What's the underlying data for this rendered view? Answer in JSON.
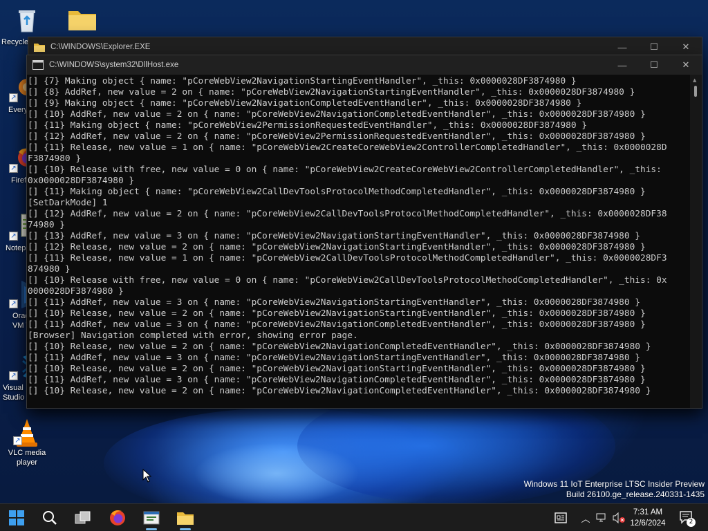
{
  "desktop": {
    "icons": [
      {
        "label": "Recycle Bin",
        "name": "recycle-bin"
      },
      {
        "label": "",
        "name": "folder"
      },
      {
        "label": "Everything",
        "name": "everything"
      },
      {
        "label": "Firefox",
        "name": "firefox"
      },
      {
        "label": "Notepad++",
        "name": "notepad-plus-plus"
      },
      {
        "label": "Oracle VM VirtualBox",
        "name": "virtualbox"
      },
      {
        "label": "Visual Studio Code",
        "name": "vscode"
      },
      {
        "label": "VLC media player",
        "name": "vlc"
      }
    ]
  },
  "windows": {
    "explorer": {
      "title": "C:\\WINDOWS\\Explorer.EXE"
    },
    "dllhost": {
      "title": "C:\\WINDOWS\\system32\\DllHost.exe"
    }
  },
  "console": {
    "lines": [
      "[] {7} Making object { name: \"pCoreWebView2NavigationStartingEventHandler\", _this: 0x0000028DF3874980 }",
      "[] {8} AddRef, new value = 2 on { name: \"pCoreWebView2NavigationStartingEventHandler\", _this: 0x0000028DF3874980 }",
      "[] {9} Making object { name: \"pCoreWebView2NavigationCompletedEventHandler\", _this: 0x0000028DF3874980 }",
      "[] {10} AddRef, new value = 2 on { name: \"pCoreWebView2NavigationCompletedEventHandler\", _this: 0x0000028DF3874980 }",
      "[] {11} Making object { name: \"pCoreWebView2PermissionRequestedEventHandler\", _this: 0x0000028DF3874980 }",
      "[] {12} AddRef, new value = 2 on { name: \"pCoreWebView2PermissionRequestedEventHandler\", _this: 0x0000028DF3874980 }",
      "[] {11} Release, new value = 1 on { name: \"pCoreWebView2CreateCoreWebView2ControllerCompletedHandler\", _this: 0x0000028D",
      "F3874980 }",
      "[] {10} Release with free, new value = 0 on { name: \"pCoreWebView2CreateCoreWebView2ControllerCompletedHandler\", _this:",
      "0x0000028DF3874980 }",
      "[] {11} Making object { name: \"pCoreWebView2CallDevToolsProtocolMethodCompletedHandler\", _this: 0x0000028DF3874980 }",
      "[SetDarkMode] 1",
      "[] {12} AddRef, new value = 2 on { name: \"pCoreWebView2CallDevToolsProtocolMethodCompletedHandler\", _this: 0x0000028DF38",
      "74980 }",
      "[] {13} AddRef, new value = 3 on { name: \"pCoreWebView2NavigationStartingEventHandler\", _this: 0x0000028DF3874980 }",
      "[] {12} Release, new value = 2 on { name: \"pCoreWebView2NavigationStartingEventHandler\", _this: 0x0000028DF3874980 }",
      "[] {11} Release, new value = 1 on { name: \"pCoreWebView2CallDevToolsProtocolMethodCompletedHandler\", _this: 0x0000028DF3",
      "874980 }",
      "[] {10} Release with free, new value = 0 on { name: \"pCoreWebView2CallDevToolsProtocolMethodCompletedHandler\", _this: 0x",
      "0000028DF3874980 }",
      "[] {11} AddRef, new value = 3 on { name: \"pCoreWebView2NavigationStartingEventHandler\", _this: 0x0000028DF3874980 }",
      "[] {10} Release, new value = 2 on { name: \"pCoreWebView2NavigationStartingEventHandler\", _this: 0x0000028DF3874980 }",
      "[] {11} AddRef, new value = 3 on { name: \"pCoreWebView2NavigationCompletedEventHandler\", _this: 0x0000028DF3874980 }",
      "[Browser] Navigation completed with error, showing error page.",
      "[] {10} Release, new value = 2 on { name: \"pCoreWebView2NavigationCompletedEventHandler\", _this: 0x0000028DF3874980 }",
      "[] {11} AddRef, new value = 3 on { name: \"pCoreWebView2NavigationStartingEventHandler\", _this: 0x0000028DF3874980 }",
      "[] {10} Release, new value = 2 on { name: \"pCoreWebView2NavigationStartingEventHandler\", _this: 0x0000028DF3874980 }",
      "[] {11} AddRef, new value = 3 on { name: \"pCoreWebView2NavigationCompletedEventHandler\", _this: 0x0000028DF3874980 }",
      "[] {10} Release, new value = 2 on { name: \"pCoreWebView2NavigationCompletedEventHandler\", _this: 0x0000028DF3874980 }"
    ]
  },
  "watermark": {
    "line1": "Windows 11 IoT Enterprise LTSC Insider Preview",
    "line2": "Build 26100.ge_release.240331-1435"
  },
  "taskbar": {
    "apps": [
      "start-icon",
      "search-icon",
      "task-view-icon",
      "firefox-icon",
      "dllhost-console-icon",
      "file-explorer-icon"
    ]
  },
  "tray": {
    "time": "7:31 AM",
    "date": "12/6/2024",
    "notification_count": "2"
  },
  "colors": {
    "console_bg": "#0c0c0c",
    "console_fg": "#cccccc",
    "titlebar_bg": "#202020",
    "taskbar_bg": "#1c1c1c",
    "accent": "#76b9ed"
  }
}
